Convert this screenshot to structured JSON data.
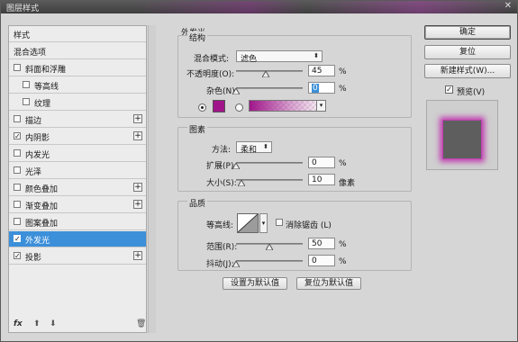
{
  "window": {
    "title": "图层样式",
    "close_icon": "close-icon"
  },
  "styles_panel": {
    "items": [
      {
        "label": "样式",
        "checkbox": false,
        "checked": false,
        "plus": false,
        "indent": 0
      },
      {
        "label": "混合选项",
        "checkbox": false,
        "checked": false,
        "plus": false,
        "indent": 0
      },
      {
        "label": "斜面和浮雕",
        "checkbox": true,
        "checked": false,
        "plus": false,
        "indent": 0
      },
      {
        "label": "等高线",
        "checkbox": true,
        "checked": false,
        "plus": false,
        "indent": 1
      },
      {
        "label": "纹理",
        "checkbox": true,
        "checked": false,
        "plus": false,
        "indent": 1
      },
      {
        "label": "描边",
        "checkbox": true,
        "checked": false,
        "plus": true,
        "indent": 0
      },
      {
        "label": "内阴影",
        "checkbox": true,
        "checked": true,
        "plus": true,
        "indent": 0
      },
      {
        "label": "内发光",
        "checkbox": true,
        "checked": false,
        "plus": false,
        "indent": 0
      },
      {
        "label": "光泽",
        "checkbox": true,
        "checked": false,
        "plus": false,
        "indent": 0
      },
      {
        "label": "颜色叠加",
        "checkbox": true,
        "checked": false,
        "plus": true,
        "indent": 0
      },
      {
        "label": "渐变叠加",
        "checkbox": true,
        "checked": false,
        "plus": true,
        "indent": 0
      },
      {
        "label": "图案叠加",
        "checkbox": true,
        "checked": false,
        "plus": false,
        "indent": 0
      },
      {
        "label": "外发光",
        "checkbox": true,
        "checked": true,
        "plus": false,
        "indent": 0,
        "selected": true
      },
      {
        "label": "投影",
        "checkbox": true,
        "checked": true,
        "plus": true,
        "indent": 0
      }
    ],
    "bottom": {
      "fx": "fx",
      "up_icon": "arrow-up-icon",
      "down_icon": "arrow-down-icon",
      "trash_icon": "trash-icon"
    }
  },
  "outer_glow": {
    "title": "外发光",
    "structure": {
      "title": "结构",
      "blend_mode_label": "混合模式:",
      "blend_mode_value": "滤色",
      "opacity_label": "不透明度(O):",
      "opacity_value": "45",
      "opacity_percent": 45,
      "noise_label": "杂色(N):",
      "noise_value": "0",
      "noise_percent": 0,
      "percent_unit": "%",
      "glow_color": "#a0168a"
    },
    "elements": {
      "title": "图素",
      "technique_label": "方法:",
      "technique_value": "柔和",
      "spread_label": "扩展(P):",
      "spread_value": "0",
      "spread_percent": 0,
      "size_label": "大小(S):",
      "size_value": "10",
      "size_unit": "像素",
      "percent_unit": "%"
    },
    "quality": {
      "title": "品质",
      "contour_label": "等高线:",
      "antialias_label": "消除锯齿 (L)",
      "range_label": "范围(R):",
      "range_value": "50",
      "range_percent": 50,
      "jitter_label": "抖动(J):",
      "jitter_value": "0",
      "jitter_percent": 0,
      "percent_unit": "%"
    },
    "set_default_label": "设置为默认值",
    "reset_default_label": "复位为默认值"
  },
  "right": {
    "ok_label": "确定",
    "reset_label": "复位",
    "new_style_label": "新建样式(W)...",
    "preview_label": "预览(V)",
    "preview_checked": true,
    "preview_fill": "#5e5e5e",
    "preview_glow": "#c040b0"
  }
}
